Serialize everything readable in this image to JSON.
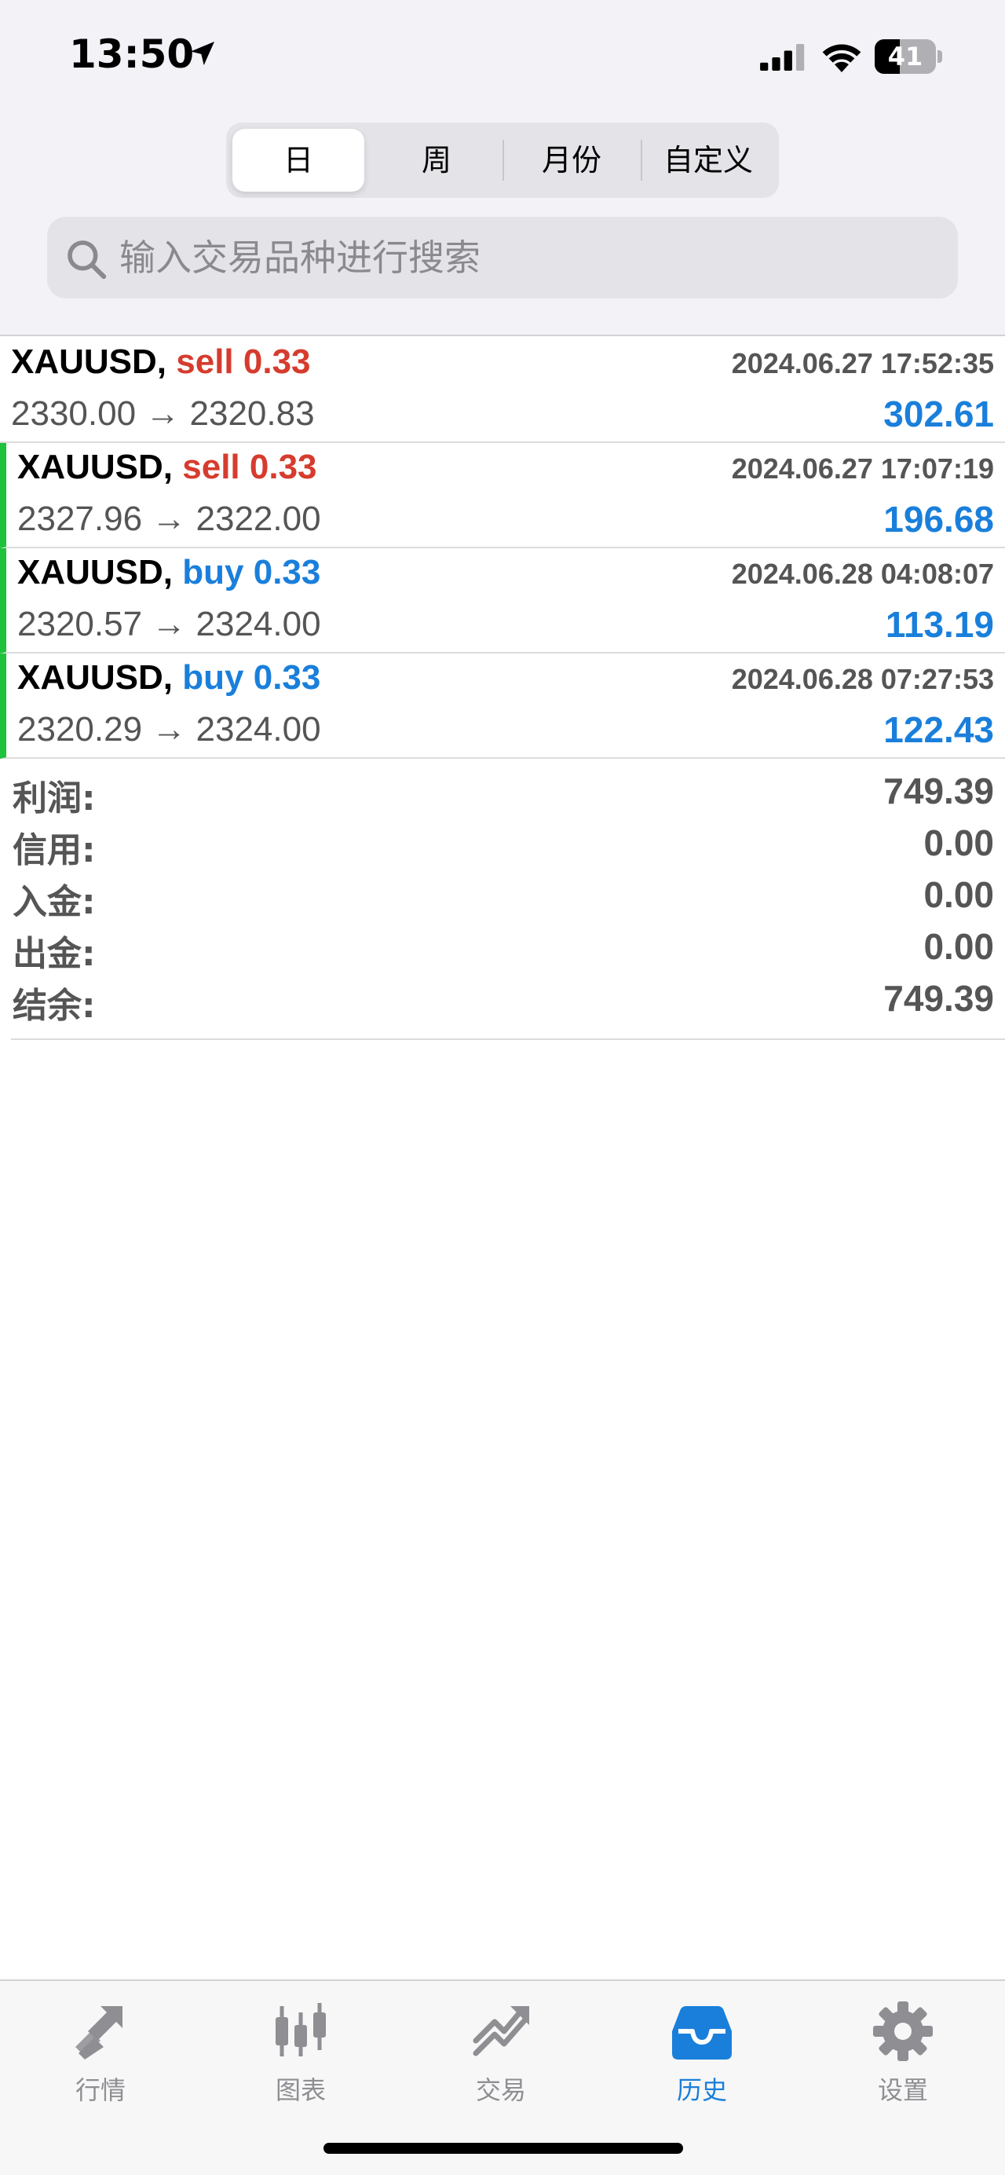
{
  "status_bar": {
    "time": "13:50",
    "battery": "41",
    "battery_level": 0.41
  },
  "segments": {
    "items": [
      {
        "label": "日",
        "active": true
      },
      {
        "label": "周",
        "active": false
      },
      {
        "label": "月份",
        "active": false
      },
      {
        "label": "自定义",
        "active": false
      }
    ]
  },
  "search": {
    "placeholder": "输入交易品种进行搜索"
  },
  "deals": [
    {
      "symbol": "XAUUSD",
      "side": "sell",
      "volume": "0.33",
      "time": "2024.06.27 17:52:35",
      "open_price": "2330.00",
      "close_price": "2320.83",
      "profit": "302.61",
      "marked": false
    },
    {
      "symbol": "XAUUSD",
      "side": "sell",
      "volume": "0.33",
      "time": "2024.06.27 17:07:19",
      "open_price": "2327.96",
      "close_price": "2322.00",
      "profit": "196.68",
      "marked": true
    },
    {
      "symbol": "XAUUSD",
      "side": "buy",
      "volume": "0.33",
      "time": "2024.06.28 04:08:07",
      "open_price": "2320.57",
      "close_price": "2324.00",
      "profit": "113.19",
      "marked": true
    },
    {
      "symbol": "XAUUSD",
      "side": "buy",
      "volume": "0.33",
      "time": "2024.06.28 07:27:53",
      "open_price": "2320.29",
      "close_price": "2324.00",
      "profit": "122.43",
      "marked": true
    }
  ],
  "summary": [
    {
      "label": "利润:",
      "value": "749.39"
    },
    {
      "label": "信用:",
      "value": "0.00"
    },
    {
      "label": "入金:",
      "value": "0.00"
    },
    {
      "label": "出金:",
      "value": "0.00"
    },
    {
      "label": "结余:",
      "value": "749.39"
    }
  ],
  "tabbar": {
    "items": [
      {
        "label": "行情",
        "icon": "quotes-icon",
        "active": false
      },
      {
        "label": "图表",
        "icon": "chart-icon",
        "active": false
      },
      {
        "label": "交易",
        "icon": "trade-icon",
        "active": false
      },
      {
        "label": "历史",
        "icon": "history-icon",
        "active": true
      },
      {
        "label": "设置",
        "icon": "gear-icon",
        "active": false
      }
    ]
  },
  "colors": {
    "sell": "#d63c2e",
    "buy": "#1a7fdb",
    "profit": "#1a7fdb",
    "marker": "#1ec23c",
    "tab_active": "#1a7fdb",
    "tab_inactive": "#8e8e93"
  }
}
